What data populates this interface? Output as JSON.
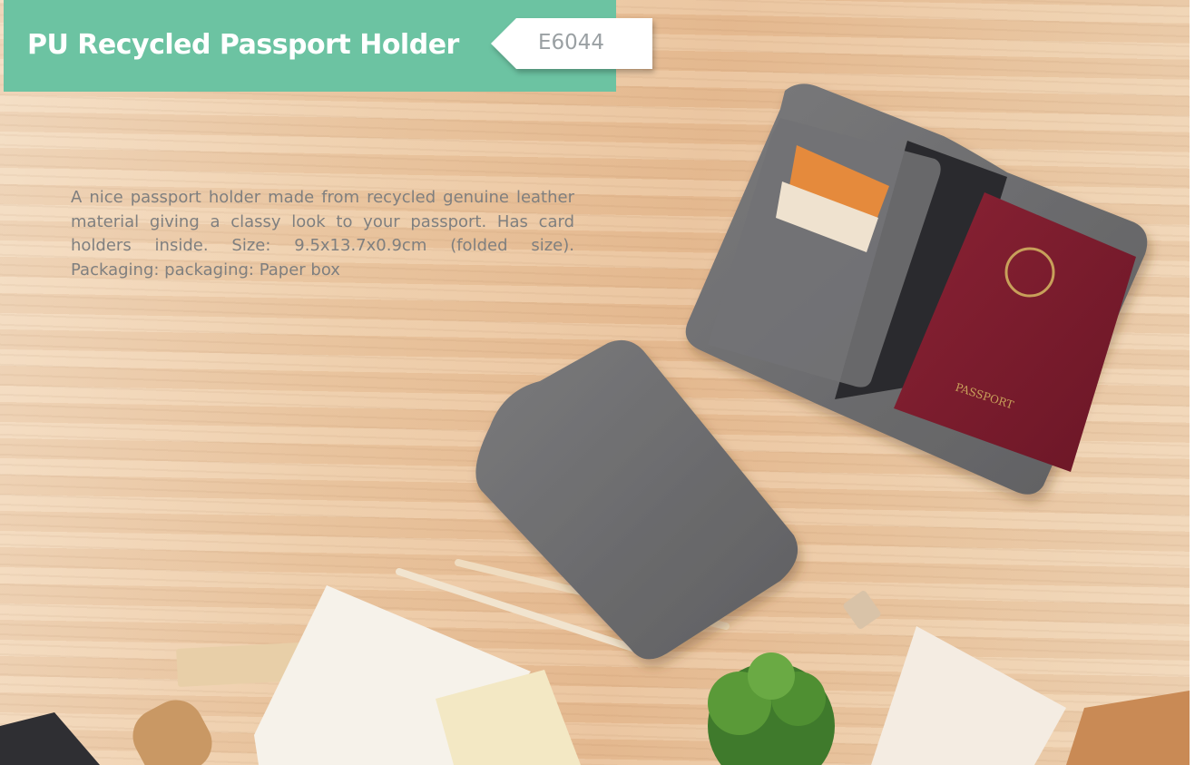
{
  "header": {
    "title": "PU Recycled Passport Holder",
    "product_code": "E6044"
  },
  "description": "A nice passport holder made from recycled genuine leather material giving a classy look to your passport. Has card holders inside. Size: 9.5x13.7x0.9cm (folded size). Packaging: packaging: Paper box",
  "product_image": {
    "passport_label": "PASSPORT"
  },
  "colors": {
    "banner": "#6cc3a2",
    "tag_background": "#ffffff",
    "tag_text": "#9aa0a3",
    "description_text": "#7f7f7f",
    "holder_felt": "#6e6e70",
    "passport": "#7a1c2c"
  }
}
